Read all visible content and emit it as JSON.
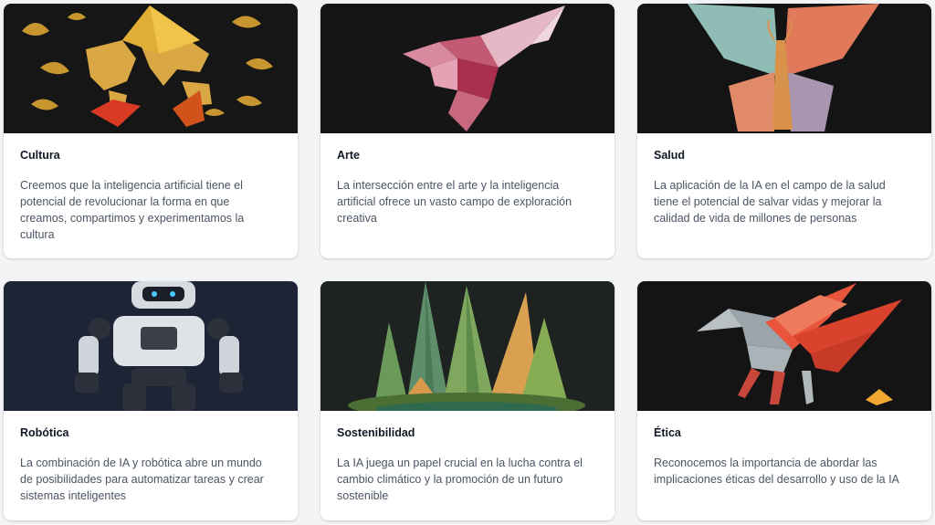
{
  "cards": [
    {
      "title": "Cultura",
      "description": "Creemos que la inteligencia artificial tiene el potencial de revolucionar la forma en que creamos, compartimos y experimentamos la cultura",
      "image": "origami-world-map-image"
    },
    {
      "title": "Arte",
      "description": "La intersección entre el arte y la inteligencia artificial ofrece un vasto campo de exploración creativa",
      "image": "origami-bird-image"
    },
    {
      "title": "Salud",
      "description": "La aplicación de la IA en el campo de la salud tiene el potencial de salvar vidas y mejorar la calidad de vida de millones de personas",
      "image": "origami-butterfly-image"
    },
    {
      "title": "Robótica",
      "description": "La combinación de IA y robótica abre un mundo de posibilidades para automatizar tareas y crear sistemas inteligentes",
      "image": "robot-image"
    },
    {
      "title": "Sostenibilidad",
      "description": "La IA juega un papel crucial en la lucha contra el cambio climático y la promoción de un futuro sostenible",
      "image": "origami-leaves-image"
    },
    {
      "title": "Ética",
      "description": "Reconocemos la importancia de abordar las implicaciones éticas del desarrollo y uso de la IA",
      "image": "origami-pegasus-image"
    }
  ],
  "colors": {
    "page_background": "#f3f4f6",
    "card_background": "#ffffff",
    "title": "#111827",
    "text": "#4b5563",
    "image_background": "#1a1a1a"
  }
}
